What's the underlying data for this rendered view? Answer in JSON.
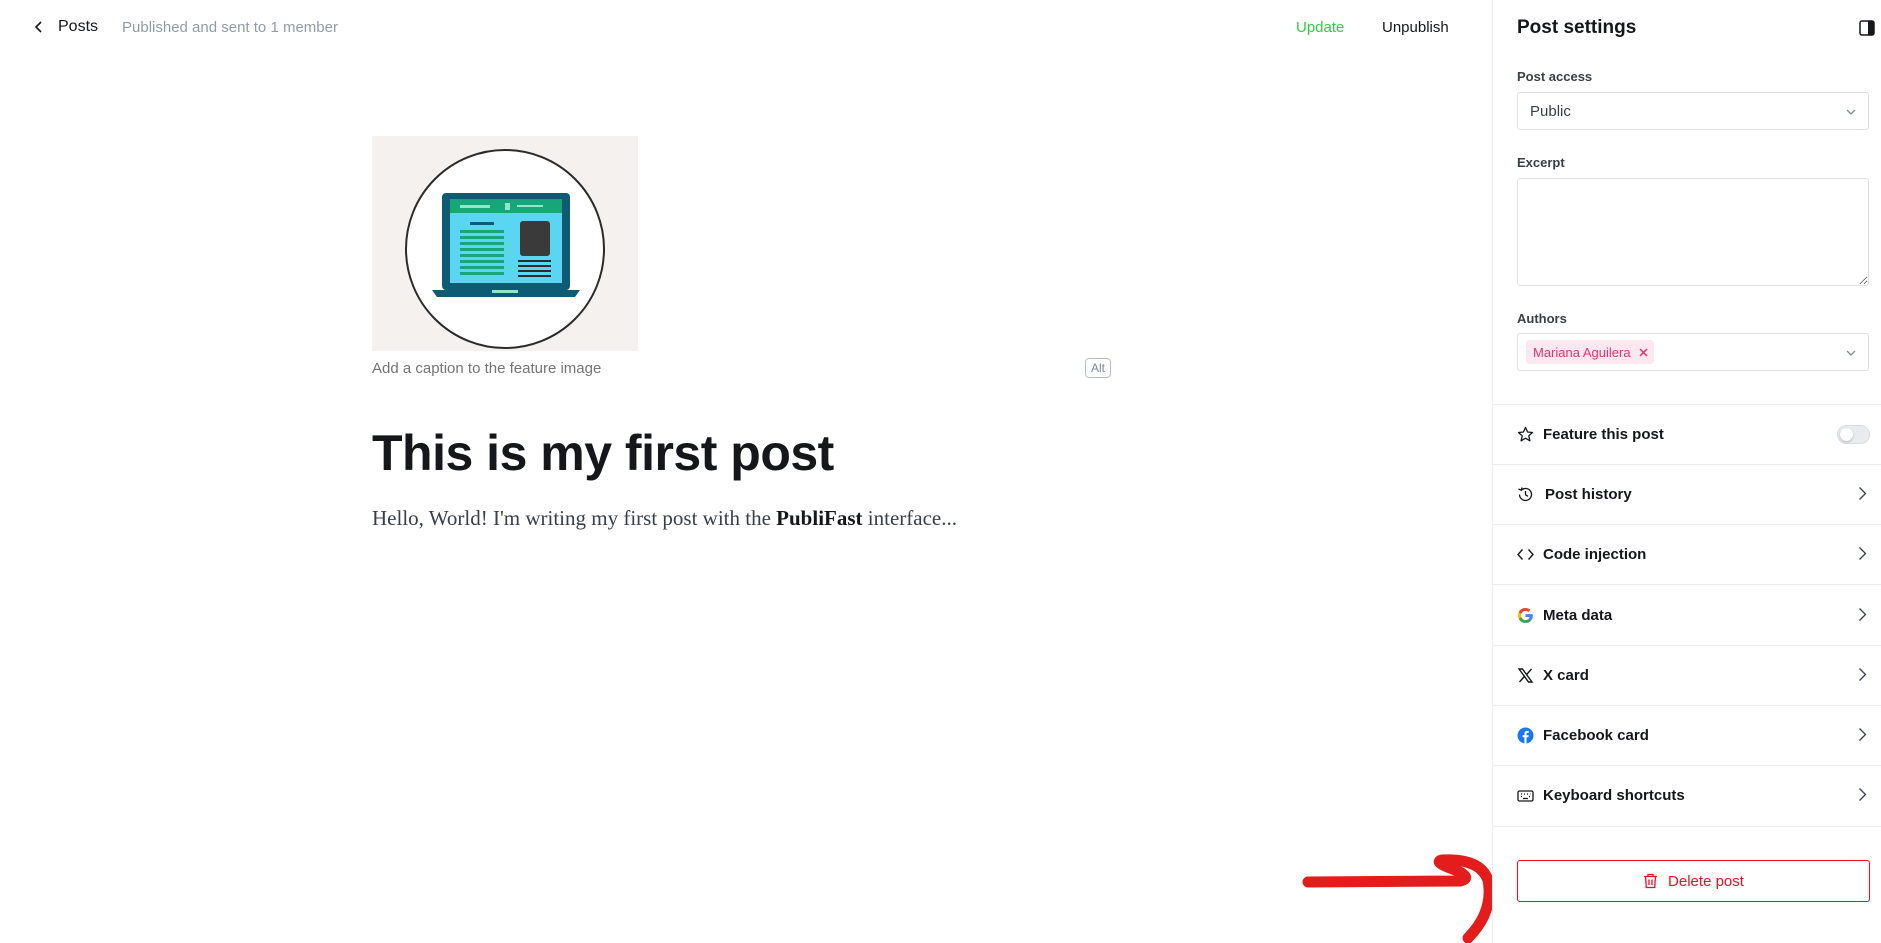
{
  "topbar": {
    "back_label": "Posts",
    "status": "Published and sent to 1 member",
    "update_label": "Update",
    "unpublish_label": "Unpublish"
  },
  "editor": {
    "caption_placeholder": "Add a caption to the feature image",
    "alt_label": "Alt",
    "title": "This is my first post",
    "body_before": "Hello, World! I'm writing my first post with the ",
    "body_bold": "PubliFast",
    "body_after": " interface..."
  },
  "sidebar": {
    "title": "Post settings",
    "post_access": {
      "label": "Post access",
      "value": "Public"
    },
    "excerpt": {
      "label": "Excerpt",
      "value": ""
    },
    "authors": {
      "label": "Authors",
      "items": [
        "Mariana Aguilera"
      ]
    },
    "feature": {
      "label": "Feature this post",
      "enabled": false
    },
    "rows": [
      {
        "label": "Post history",
        "icon": "history-icon"
      },
      {
        "label": "Code injection",
        "icon": "code-icon"
      },
      {
        "label": "Meta data",
        "icon": "google-icon"
      },
      {
        "label": "X card",
        "icon": "x-logo-icon"
      },
      {
        "label": "Facebook card",
        "icon": "facebook-icon"
      },
      {
        "label": "Keyboard shortcuts",
        "icon": "keyboard-icon"
      }
    ],
    "delete_label": "Delete post"
  },
  "colors": {
    "update": "#30cf43",
    "danger": "#f50b23",
    "author_tag_bg": "#fde8f0",
    "author_tag_text": "#e8336d",
    "annotation": "#e31c1c"
  }
}
